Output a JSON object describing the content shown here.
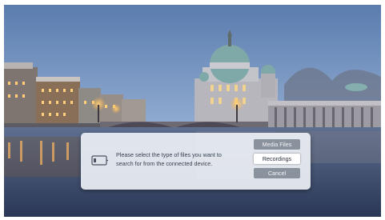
{
  "screen": {
    "name": "tv-connected-device-popup",
    "background_scene": "Berlin Cathedral riverside at dusk",
    "colors": {
      "sky_top": "#5d7fb0",
      "sky_bottom": "#b9cbe3",
      "river": "#2f3f5f",
      "dialog_bg": "#ebeef3",
      "button_idle": "#8a929e",
      "button_focused": "#ffffff"
    }
  },
  "dialog": {
    "icon": "usb-device-icon",
    "message": "Please select the type of files you want to search for from the connected device.",
    "options": [
      {
        "label": "Media Files",
        "focused": false
      },
      {
        "label": "Recordings",
        "focused": true
      },
      {
        "label": "Cancel",
        "focused": false
      }
    ]
  }
}
